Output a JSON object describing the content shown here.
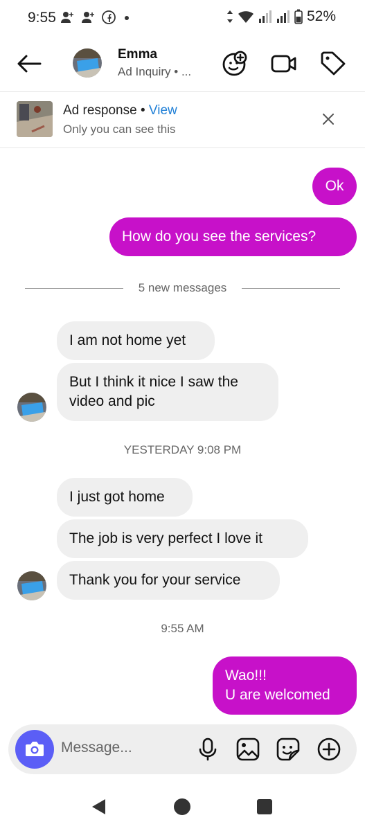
{
  "status_bar": {
    "time": "9:55",
    "battery": "52%",
    "icons": [
      "person-add-icon",
      "person-add-icon",
      "facebook-icon",
      "dot-icon",
      "data-arrows-icon",
      "wifi-icon",
      "signal-icon",
      "signal-icon",
      "battery-icon"
    ]
  },
  "header": {
    "contact_name": "Emma",
    "contact_subtitle": "Ad Inquiry • ...",
    "actions": [
      "add-person-icon",
      "video-call-icon",
      "tag-icon"
    ]
  },
  "ad_banner": {
    "title": "Ad response",
    "separator": " • ",
    "view_label": "View",
    "subtitle": "Only you can see this"
  },
  "messages": {
    "sent_1": "Ok",
    "sent_2": "How do you see the services?",
    "new_messages_label": "5 new messages",
    "received_1": "I am not home yet",
    "received_2_line1": "But I think it nice I saw the",
    "received_2_line2": "video and pic",
    "timestamp_1": "YESTERDAY 9:08 PM",
    "received_3": "I just got home",
    "received_4": "The job is very perfect I love it",
    "received_5": "Thank you for your service",
    "timestamp_2": "9:55 AM",
    "sent_3_line1": "Wao!!!",
    "sent_3_line2": "U are welcomed"
  },
  "composer": {
    "placeholder": "Message...",
    "icons": [
      "camera-icon",
      "microphone-icon",
      "gallery-icon",
      "sticker-icon",
      "plus-icon"
    ]
  },
  "colors": {
    "sent_bubble": "#c711c9",
    "received_bubble": "#efefef",
    "camera_button": "#5b5ef6",
    "link": "#1f7fd6"
  }
}
